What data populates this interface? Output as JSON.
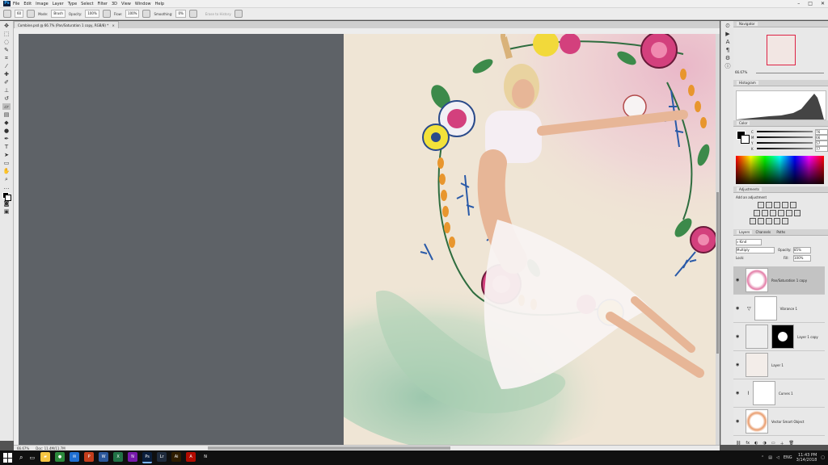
{
  "app": {
    "name": "Photoshop",
    "logo_text": "Ps"
  },
  "menu": [
    "File",
    "Edit",
    "Image",
    "Layer",
    "Type",
    "Select",
    "Filter",
    "3D",
    "View",
    "Window",
    "Help"
  ],
  "window_controls": [
    "–",
    "□",
    "✕"
  ],
  "options_bar": {
    "brush_size": "60",
    "mode_label": "Mode:",
    "mode_value": "Brush",
    "opacity_label": "Opacity:",
    "opacity_value": "100%",
    "flow_label": "Flow:",
    "flow_value": "100%",
    "smoothing_label": "Smoothing:",
    "smoothing_value": "0%",
    "erase_history": "Erase to History"
  },
  "document": {
    "tab_title": "Combine.psd @ 66.7% (Pan/Saturation 1 copy, RGB/8) *",
    "zoom": "66.67%",
    "doc_info": "Doc: 11.4M/11.7M"
  },
  "panels": {
    "navigator": {
      "title": "Navigator",
      "zoom": "66.67%"
    },
    "histogram": {
      "title": "Histogram"
    },
    "color": {
      "title": "Color",
      "channels": [
        {
          "label": "C",
          "value": "76"
        },
        {
          "label": "M",
          "value": "66"
        },
        {
          "label": "Y",
          "value": "57"
        },
        {
          "label": "K",
          "value": "77"
        }
      ]
    },
    "adjustments": {
      "title": "Adjustments",
      "subtitle": "Add an adjustment"
    },
    "layers": {
      "tabs": [
        "Layers",
        "Channels",
        "Paths"
      ],
      "kind_label": "Kind",
      "blend_mode": "Multiply",
      "opacity_label": "Opacity:",
      "opacity_value": "85%",
      "lock_label": "Lock:",
      "fill_label": "Fill:",
      "fill_value": "100%",
      "items": [
        {
          "name": "Pan/Saturation 1 copy"
        },
        {
          "name": "Vibrance 1"
        },
        {
          "name": "Layer 1 copy"
        },
        {
          "name": "Layer 1"
        },
        {
          "name": "Curves 1"
        },
        {
          "name": "Vector Smart Object"
        }
      ]
    }
  },
  "taskbar": {
    "apps": [
      {
        "name": "File Explorer",
        "color": "#f5c542",
        "glyph": "▰"
      },
      {
        "name": "Chrome",
        "color": "#2c8a3c",
        "glyph": "●"
      },
      {
        "name": "Mail",
        "color": "#1f6fd1",
        "glyph": "✉"
      },
      {
        "name": "PowerPoint",
        "color": "#c43e1c",
        "glyph": "P"
      },
      {
        "name": "Word",
        "color": "#2b579a",
        "glyph": "W"
      },
      {
        "name": "Excel",
        "color": "#217346",
        "glyph": "X"
      },
      {
        "name": "OneNote",
        "color": "#7719aa",
        "glyph": "N"
      },
      {
        "name": "Photoshop",
        "color": "#0a1e3c",
        "glyph": "Ps"
      },
      {
        "name": "Lightroom",
        "color": "#1f2b3d",
        "glyph": "Lr"
      },
      {
        "name": "Illustrator",
        "color": "#2e1d00",
        "glyph": "Ai"
      },
      {
        "name": "Acrobat",
        "color": "#b30b00",
        "glyph": "A"
      },
      {
        "name": "Netflix",
        "color": "#111111",
        "glyph": "N"
      }
    ],
    "tray": {
      "lang": "ENG",
      "time": "11:43 PM",
      "date": "3/14/2018"
    }
  }
}
